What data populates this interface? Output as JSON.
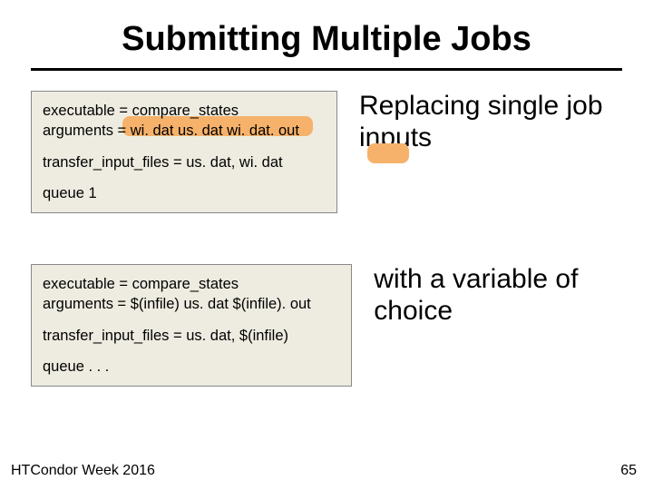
{
  "title": "Submitting Multiple Jobs",
  "box1": {
    "line1": "executable = compare_states",
    "line2": "arguments = wi. dat us. dat wi. dat. out",
    "line3": "transfer_input_files = us. dat, wi. dat",
    "line4": "queue 1"
  },
  "side1": "Replacing single job inputs",
  "box2": {
    "line1": "executable = compare_states",
    "line2": "arguments = $(infile) us. dat $(infile). out",
    "line3": "transfer_input_files = us. dat, $(infile)",
    "line4": "queue . . ."
  },
  "side2": "with a variable of choice",
  "footer": "HTCondor Week 2016",
  "page": "65"
}
